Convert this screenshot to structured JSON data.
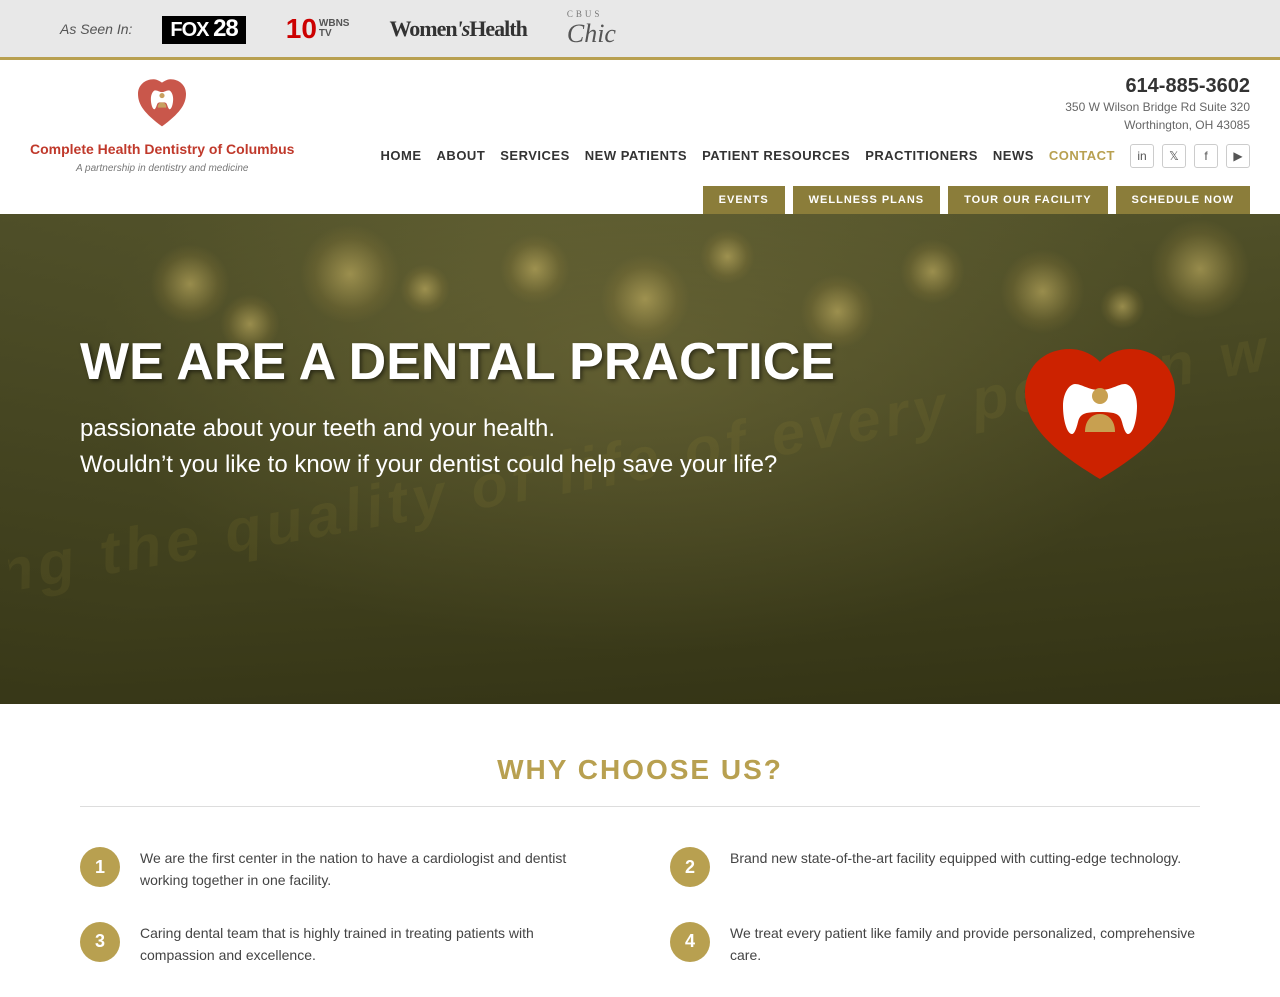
{
  "as_seen_in": {
    "label": "As Seen In:",
    "logos": [
      {
        "name": "FOX 28",
        "type": "fox"
      },
      {
        "name": "10 WBNS TV",
        "type": "wbns"
      },
      {
        "name": "Women's Health",
        "type": "womens"
      },
      {
        "name": "CBUS Chic",
        "type": "cbus"
      }
    ]
  },
  "header": {
    "logo": {
      "name": "Complete Health Dentistry of Columbus",
      "tagline": "A partnership in dentistry and medicine"
    },
    "contact": {
      "phone": "614-885-3602",
      "address_line1": "350 W Wilson Bridge Rd Suite 320",
      "address_line2": "Worthington, OH 43085"
    },
    "nav": {
      "items": [
        {
          "label": "HOME",
          "active": false
        },
        {
          "label": "ABOUT",
          "active": false
        },
        {
          "label": "SERVICES",
          "active": false
        },
        {
          "label": "NEW PATIENTS",
          "active": false
        },
        {
          "label": "PATIENT RESOURCES",
          "active": false
        },
        {
          "label": "PRACTITIONERS",
          "active": false
        },
        {
          "label": "NEWS",
          "active": false
        },
        {
          "label": "CONTACT",
          "active": true
        }
      ]
    },
    "action_buttons": [
      {
        "label": "EVENTS"
      },
      {
        "label": "WELLNESS PLANS"
      },
      {
        "label": "TOUR OUR FACILITY"
      },
      {
        "label": "SCHEDULE NOW"
      }
    ]
  },
  "hero": {
    "title": "WE ARE A DENTAL PRACTICE",
    "subtitle_line1": "passionate about your teeth and your health.",
    "subtitle_line2": "Wouldn’t you like to know if your dentist could help save your life?"
  },
  "why_section": {
    "title_plain": "WHY ",
    "title_bold": "CHOOSE US?",
    "features": [
      {
        "number": "1",
        "text": "We are the first center in the nation to have a cardiologist and dentist working together in one facility."
      },
      {
        "number": "2",
        "text": "Brand new state-of-the-art facility equipped with cutting-edge technology."
      },
      {
        "number": "3",
        "text": "Caring dental team that is highly trained in treating patients with compassion and excellence."
      },
      {
        "number": "4",
        "text": "We treat every patient like family and provide personalized, comprehensive care."
      }
    ]
  }
}
